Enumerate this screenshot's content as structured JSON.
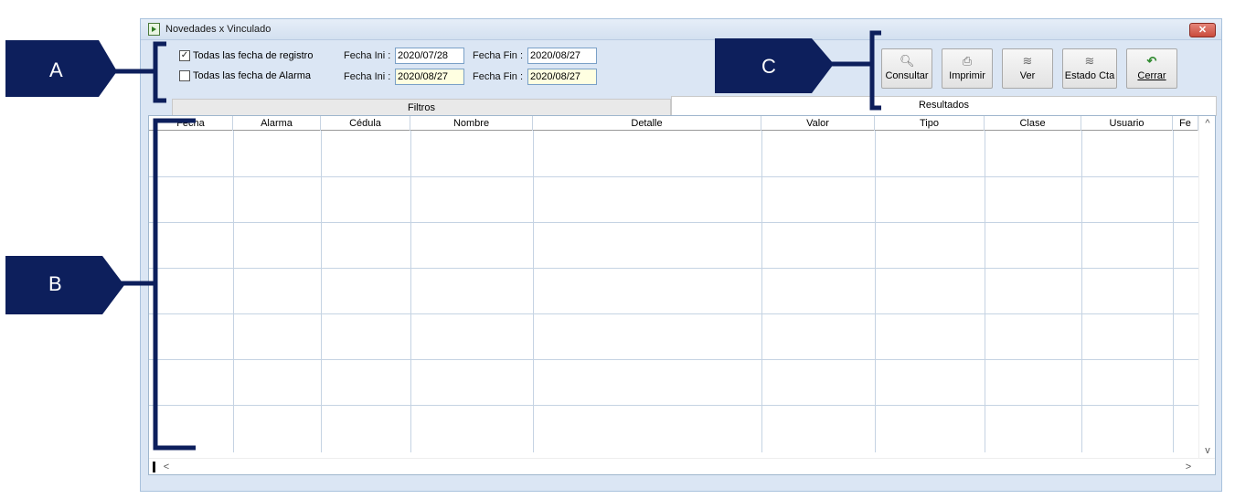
{
  "window": {
    "title": "Novedades x Vinculado",
    "close_label": "✕"
  },
  "filters": {
    "registro_label": "Todas las fecha de registro",
    "registro_checked": true,
    "alarma_label": "Todas las fecha de Alarma",
    "alarma_checked": false,
    "fecha_ini_label": "Fecha Ini :",
    "fecha_fin_label": "Fecha Fin :",
    "row1": {
      "ini": "2020/07/28",
      "fin": "2020/08/27"
    },
    "row2": {
      "ini": "2020/08/27",
      "fin": "2020/08/27"
    }
  },
  "toolbar": {
    "buttons": [
      {
        "label": "Consultar",
        "icon": "magnifier-icon"
      },
      {
        "label": "Imprimir",
        "icon": "printer-icon"
      },
      {
        "label": "Ver",
        "icon": "view-icon"
      },
      {
        "label": "Estado Cta",
        "icon": "account-state-icon"
      },
      {
        "label": "Cerrar",
        "icon": "undo-arrow-icon"
      }
    ]
  },
  "tabs": {
    "filtros": "Filtros",
    "resultados": "Resultados"
  },
  "grid": {
    "columns": [
      "Fecha",
      "Alarma",
      "Cédula",
      "Nombre",
      "Detalle",
      "Valor",
      "Tipo",
      "Clase",
      "Usuario",
      "Fe"
    ],
    "scroll_up": "^",
    "scroll_down": "v",
    "scroll_left": "<",
    "scroll_right": ">"
  },
  "annotations": {
    "a": "A",
    "b": "B",
    "c": "C"
  },
  "colors": {
    "annotation_fill": "#0d1f5c",
    "window_bg": "#dbe6f4",
    "grid_line": "#c5d3e3"
  }
}
